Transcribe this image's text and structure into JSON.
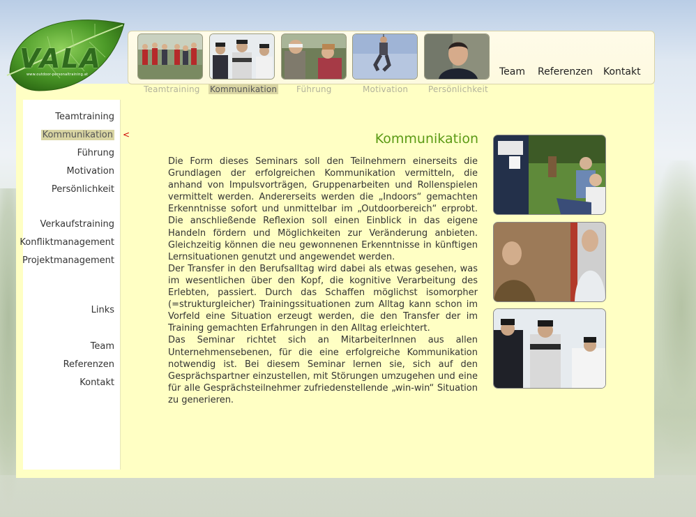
{
  "logo": {
    "text": "VALA",
    "url": "www.outdoor-personaltraining.at"
  },
  "top_nav": {
    "team": "Team",
    "referenzen": "Referenzen",
    "kontakt": "Kontakt"
  },
  "sub_tabs": [
    "Teamtraining",
    "Kommunikation",
    "Führung",
    "Motivation",
    "Persönlichkeit"
  ],
  "sidebar": {
    "group1": [
      "Teamtraining",
      "Kommunikation",
      "Führung",
      "Motivation",
      "Persönlichkeit"
    ],
    "group2": [
      "Verkaufstraining",
      "Konfliktmanagement",
      "Projektmanagement"
    ],
    "group3": [
      "Links"
    ],
    "group4": [
      "Team",
      "Referenzen",
      "Kontakt"
    ],
    "active_marker": "<"
  },
  "main": {
    "title": "Kommunikation",
    "paragraphs": [
      "Die Form dieses Seminars soll den Teilnehmern einerseits die Grundlagen der erfolgreichen Kommunikation vermitteln, die anhand von Impulsvorträgen, Gruppenarbeiten und Rollenspielen vermittelt werden. Andererseits werden die „Indoors“ gemachten Erkenntnisse sofort und unmittelbar im „Outdoorbereich“ erprobt. Die anschließende Reflexion soll einen Einblick in das eigene Handeln fördern und Möglichkeiten zur Veränderung anbieten. Gleichzeitig können die neu gewonnenen Erkenntnisse in künftigen Lernsituationen genutzt und angewendet werden.",
      "Der Transfer in den Berufsalltag wird dabei als etwas gesehen, was im wesentlichen über den Kopf, die kognitive Verarbeitung des Erlebten, passiert. Durch das Schaffen möglichst isomorpher (=strukturgleicher) Trainingssituationen zum Alltag kann schon im Vorfeld eine Situation erzeugt werden, die den Transfer der im Training gemachten Erfahrungen in den Alltag erleichtert.",
      "Das Seminar richtet sich an MitarbeiterInnen aus allen Unternehmensebenen, für die eine erfolgreiche Kommunikation notwendig ist. Bei diesem Seminar lernen sie, sich auf den Gesprächspartner einzustellen, mit Störungen umzugehen und eine für alle Gesprächsteilnehmer zufriedenstellende „win-win“ Situation zu generieren."
    ]
  },
  "colors": {
    "panel": "#ffffc4",
    "title": "#5b9a15",
    "active_bg": "#d9d5a3",
    "marker": "#cc0000"
  }
}
